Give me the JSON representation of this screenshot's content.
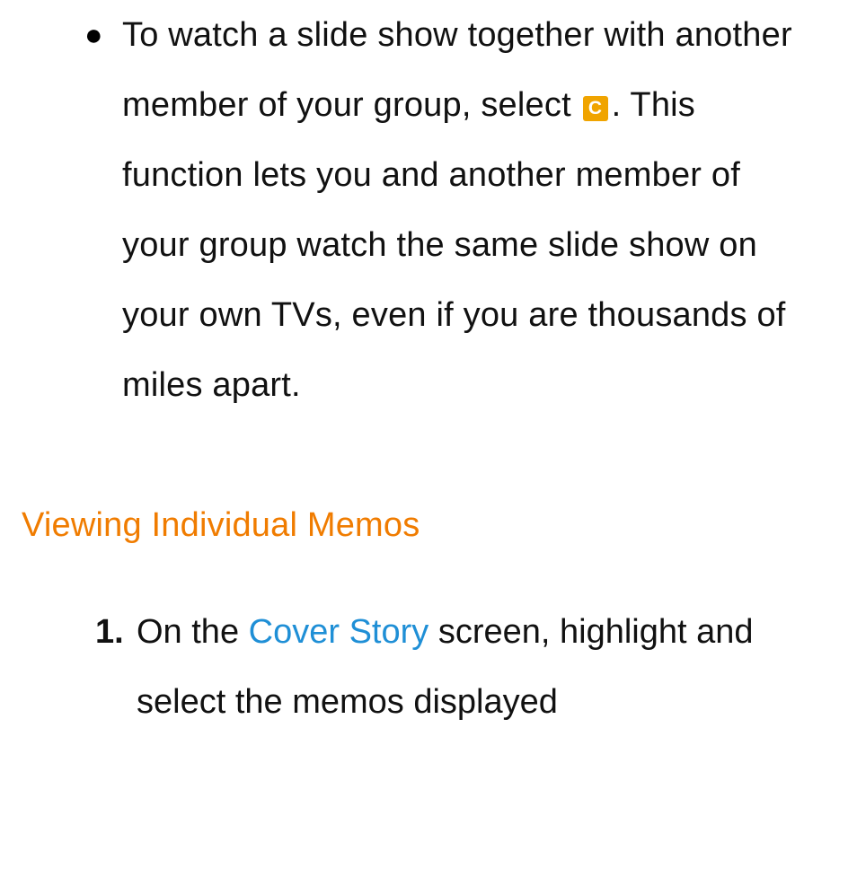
{
  "bullet": {
    "pre": "To watch a slide show together with another member of your group, select ",
    "badge": "C",
    "post": ". This function lets you and another member of your group watch the same slide show on your own TVs, even if you are thousands of miles apart."
  },
  "heading": "Viewing Individual Memos",
  "step": {
    "number": "1.",
    "pre": "On the ",
    "link": "Cover Story",
    "post": " screen, highlight and select the memos displayed"
  }
}
